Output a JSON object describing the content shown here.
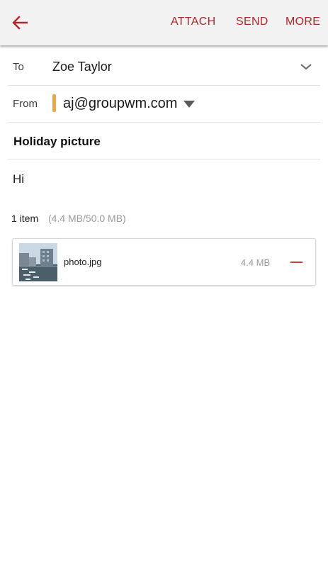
{
  "colors": {
    "accent": "#b0272b",
    "account_marker": "#e8a94a",
    "remove": "#d03a3a"
  },
  "toolbar": {
    "back_icon": "arrow-left-icon",
    "attach_label": "ATTACH",
    "send_label": "SEND",
    "more_label": "MORE"
  },
  "compose": {
    "to_label": "To",
    "to_value": "Zoe Taylor",
    "to_expand_icon": "chevron-down-icon",
    "from_label": "From",
    "from_value": "aj@groupwm.com",
    "from_dropdown_icon": "caret-down-icon",
    "subject": "Holiday picture",
    "body": "Hi"
  },
  "attachments": {
    "summary": "1 item",
    "total_size": "(4.4 MB/50.0 MB)",
    "items": [
      {
        "name": "photo.jpg",
        "size": "4.4 MB",
        "remove_icon": "minus-icon"
      }
    ]
  }
}
